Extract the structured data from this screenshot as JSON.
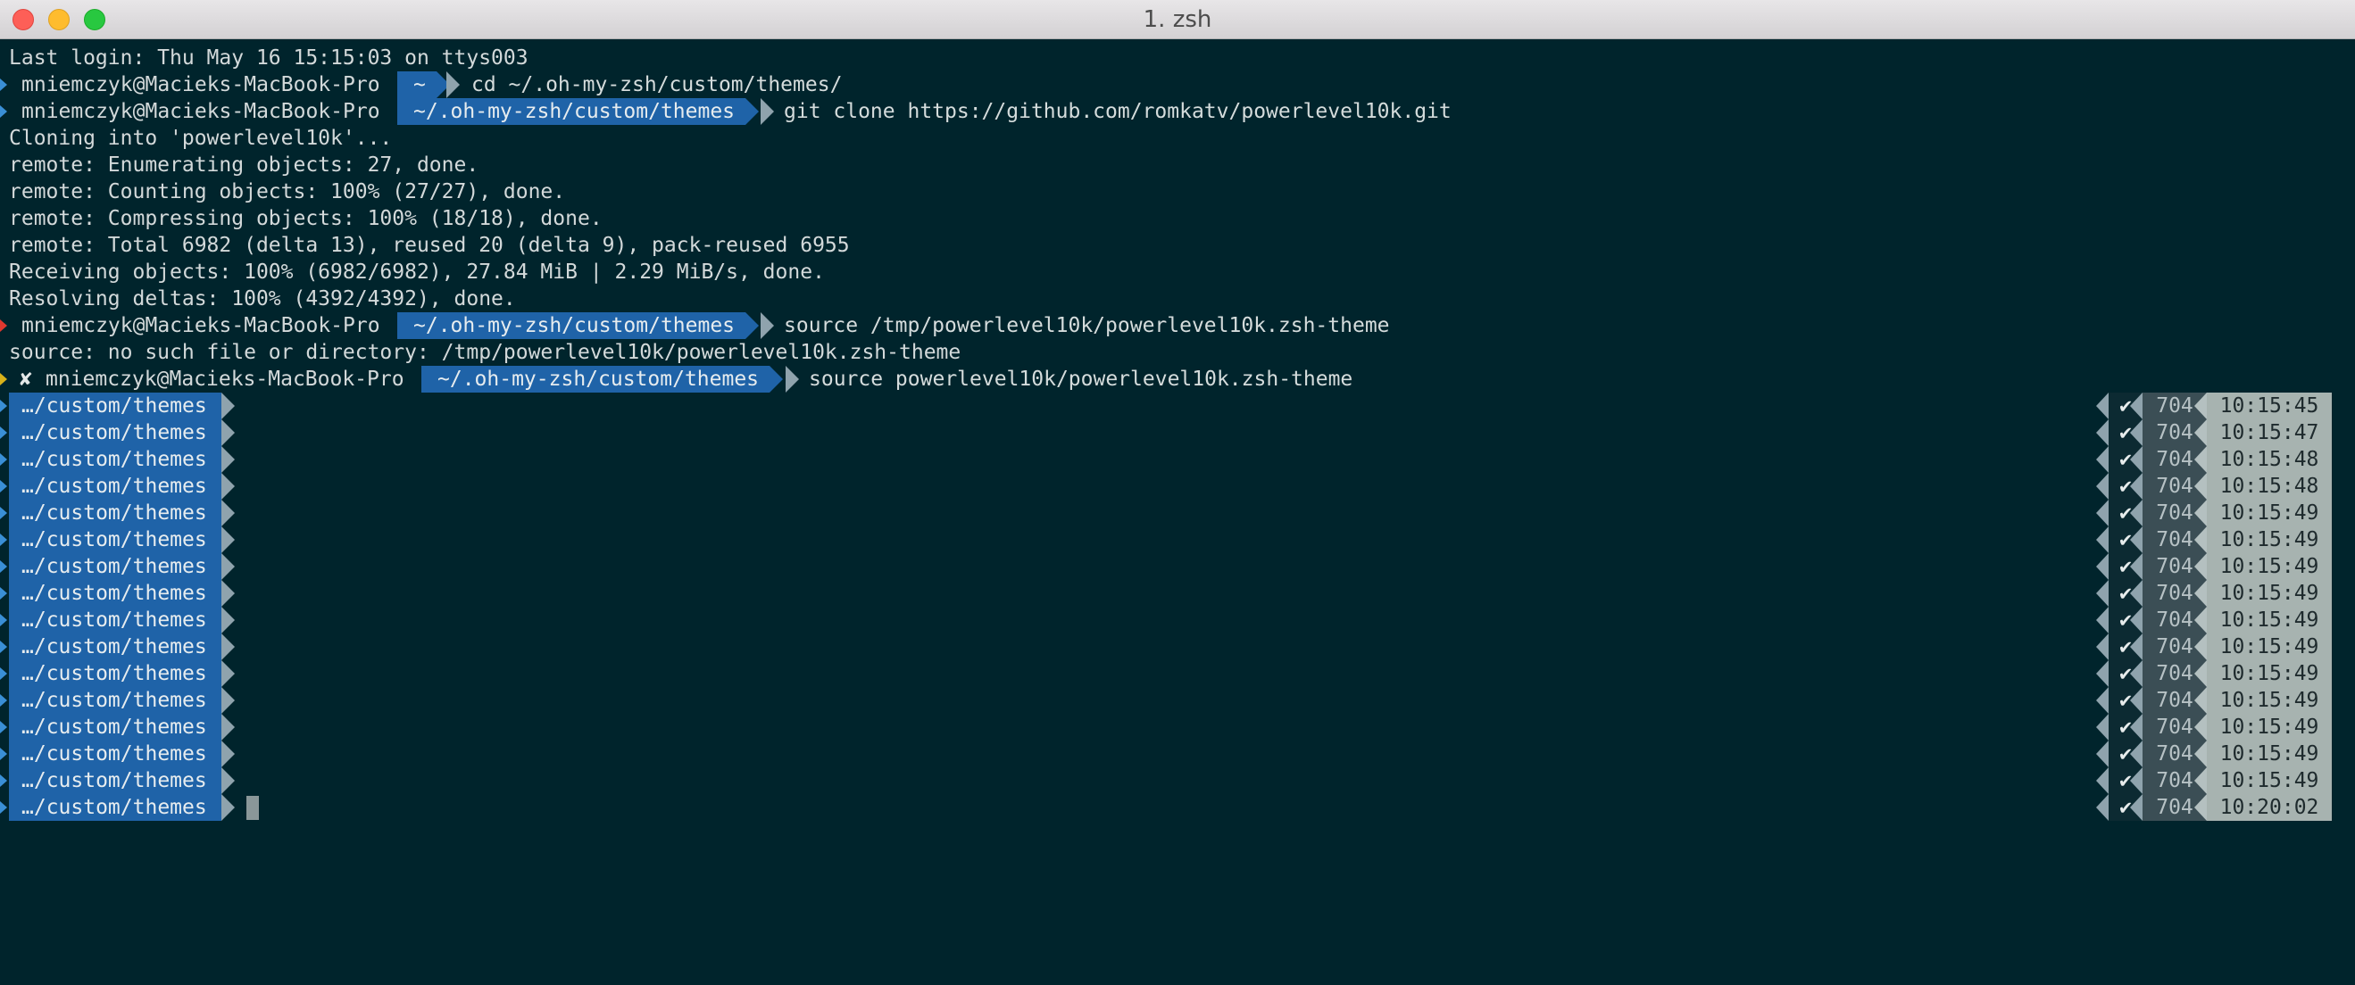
{
  "window": {
    "title": "1. zsh"
  },
  "colors": {
    "terminal_bg": "#00242c",
    "dir_segment": "#1f63a8",
    "separator": "#8fa3ad",
    "time_segment": "#a7b3b0",
    "status_segment": "#3b4e55"
  },
  "terminal": {
    "last_login": "Last login: Thu May 16 15:15:03 on ttys003",
    "host": "mniemczyk@Macieks-MacBook-Pro",
    "prompt1": {
      "dir": "~",
      "command": "cd ~/.oh-my-zsh/custom/themes/"
    },
    "prompt2": {
      "dir": "~/.oh-my-zsh/custom/themes",
      "command": "git clone https://github.com/romkatv/powerlevel10k.git"
    },
    "output1": [
      "Cloning into 'powerlevel10k'...",
      "remote: Enumerating objects: 27, done.",
      "remote: Counting objects: 100% (27/27), done.",
      "remote: Compressing objects: 100% (18/18), done.",
      "remote: Total 6982 (delta 13), reused 20 (delta 9), pack-reused 6955",
      "Receiving objects: 100% (6982/6982), 27.84 MiB | 2.29 MiB/s, done.",
      "Resolving deltas: 100% (4392/4392), done."
    ],
    "prompt3": {
      "dir": "~/.oh-my-zsh/custom/themes",
      "command": "source /tmp/powerlevel10k/powerlevel10k.zsh-theme"
    },
    "error_line": "source: no such file or directory: /tmp/powerlevel10k/powerlevel10k.zsh-theme",
    "prompt4": {
      "status_glyph": "✘",
      "dir": "~/.oh-my-zsh/custom/themes",
      "command": "source powerlevel10k/powerlevel10k.zsh-theme"
    },
    "p10k_prompts": [
      {
        "dir": "…/custom/themes",
        "check": "✔",
        "number": "704",
        "time": "10:15:45"
      },
      {
        "dir": "…/custom/themes",
        "check": "✔",
        "number": "704",
        "time": "10:15:47"
      },
      {
        "dir": "…/custom/themes",
        "check": "✔",
        "number": "704",
        "time": "10:15:48"
      },
      {
        "dir": "…/custom/themes",
        "check": "✔",
        "number": "704",
        "time": "10:15:48"
      },
      {
        "dir": "…/custom/themes",
        "check": "✔",
        "number": "704",
        "time": "10:15:49"
      },
      {
        "dir": "…/custom/themes",
        "check": "✔",
        "number": "704",
        "time": "10:15:49"
      },
      {
        "dir": "…/custom/themes",
        "check": "✔",
        "number": "704",
        "time": "10:15:49"
      },
      {
        "dir": "…/custom/themes",
        "check": "✔",
        "number": "704",
        "time": "10:15:49"
      },
      {
        "dir": "…/custom/themes",
        "check": "✔",
        "number": "704",
        "time": "10:15:49"
      },
      {
        "dir": "…/custom/themes",
        "check": "✔",
        "number": "704",
        "time": "10:15:49"
      },
      {
        "dir": "…/custom/themes",
        "check": "✔",
        "number": "704",
        "time": "10:15:49"
      },
      {
        "dir": "…/custom/themes",
        "check": "✔",
        "number": "704",
        "time": "10:15:49"
      },
      {
        "dir": "…/custom/themes",
        "check": "✔",
        "number": "704",
        "time": "10:15:49"
      },
      {
        "dir": "…/custom/themes",
        "check": "✔",
        "number": "704",
        "time": "10:15:49"
      },
      {
        "dir": "…/custom/themes",
        "check": "✔",
        "number": "704",
        "time": "10:15:49"
      },
      {
        "dir": "…/custom/themes",
        "check": "✔",
        "number": "704",
        "time": "10:20:02"
      }
    ]
  }
}
